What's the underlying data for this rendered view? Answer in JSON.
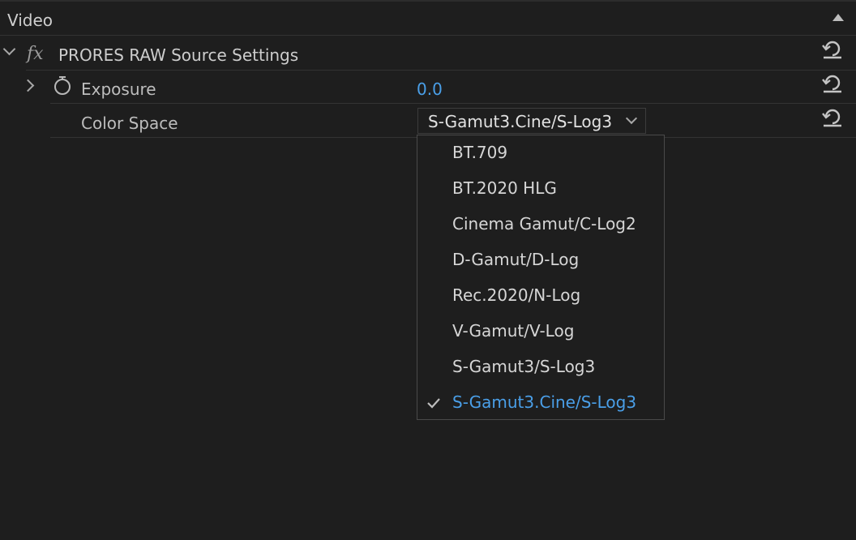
{
  "panel": {
    "section_label": "Video"
  },
  "effect": {
    "title": "PRORES RAW Source Settings",
    "fx_label": "fx"
  },
  "exposure": {
    "label": "Exposure",
    "value": "0.0"
  },
  "color_space": {
    "label": "Color Space",
    "selected": "S-Gamut3.Cine/S-Log3",
    "options": [
      {
        "label": "BT.709",
        "selected": false
      },
      {
        "label": "BT.2020 HLG",
        "selected": false
      },
      {
        "label": "Cinema Gamut/C-Log2",
        "selected": false
      },
      {
        "label": "D-Gamut/D-Log",
        "selected": false
      },
      {
        "label": "Rec.2020/N-Log",
        "selected": false
      },
      {
        "label": "V-Gamut/V-Log",
        "selected": false
      },
      {
        "label": "S-Gamut3/S-Log3",
        "selected": false
      },
      {
        "label": "S-Gamut3.Cine/S-Log3",
        "selected": true
      }
    ]
  },
  "icons": {
    "collapse": "triangle-up-icon",
    "expand": "chevron-icon",
    "stopwatch": "stopwatch-icon",
    "reset": "reset-icon",
    "check": "checkmark-icon"
  },
  "colors": {
    "background": "#1e1e1e",
    "accent": "#4a9fe8",
    "text": "#c8c8c8"
  }
}
